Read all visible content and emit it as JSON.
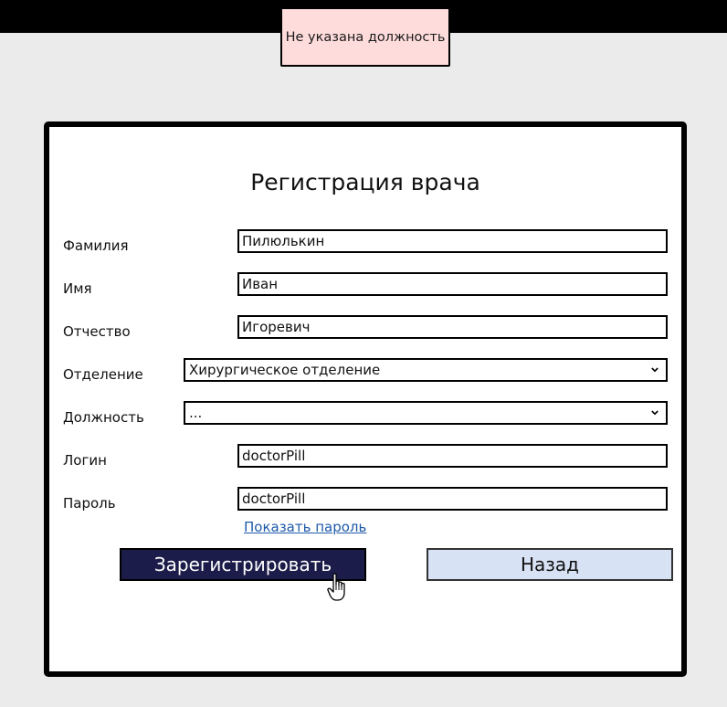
{
  "toast": {
    "message": "Не указана должность",
    "bg_color": "#ffdcdc"
  },
  "form": {
    "title": "Регистрация врача",
    "surname": {
      "label": "Фамилия",
      "value": "Пилюлькин"
    },
    "name": {
      "label": "Имя",
      "value": "Иван"
    },
    "patronymic": {
      "label": "Отчество",
      "value": "Игоревич"
    },
    "department": {
      "label": "Отделение",
      "selected": "Хирургическое отделение"
    },
    "position": {
      "label": "Должность",
      "selected": "..."
    },
    "login": {
      "label": "Логин",
      "value": "doctorPill"
    },
    "password": {
      "label": "Пароль",
      "value": "doctorPill"
    },
    "show_password_link": "Показать пароль",
    "register_button": "Зарегистрировать",
    "back_button": "Назад"
  },
  "colors": {
    "primary_button": "#1c1c4a",
    "secondary_button": "#d8e2f5",
    "link": "#1e5aa8"
  },
  "icons": {
    "dropdown": "chevron-down-icon",
    "cursor": "hand-pointer-icon"
  }
}
